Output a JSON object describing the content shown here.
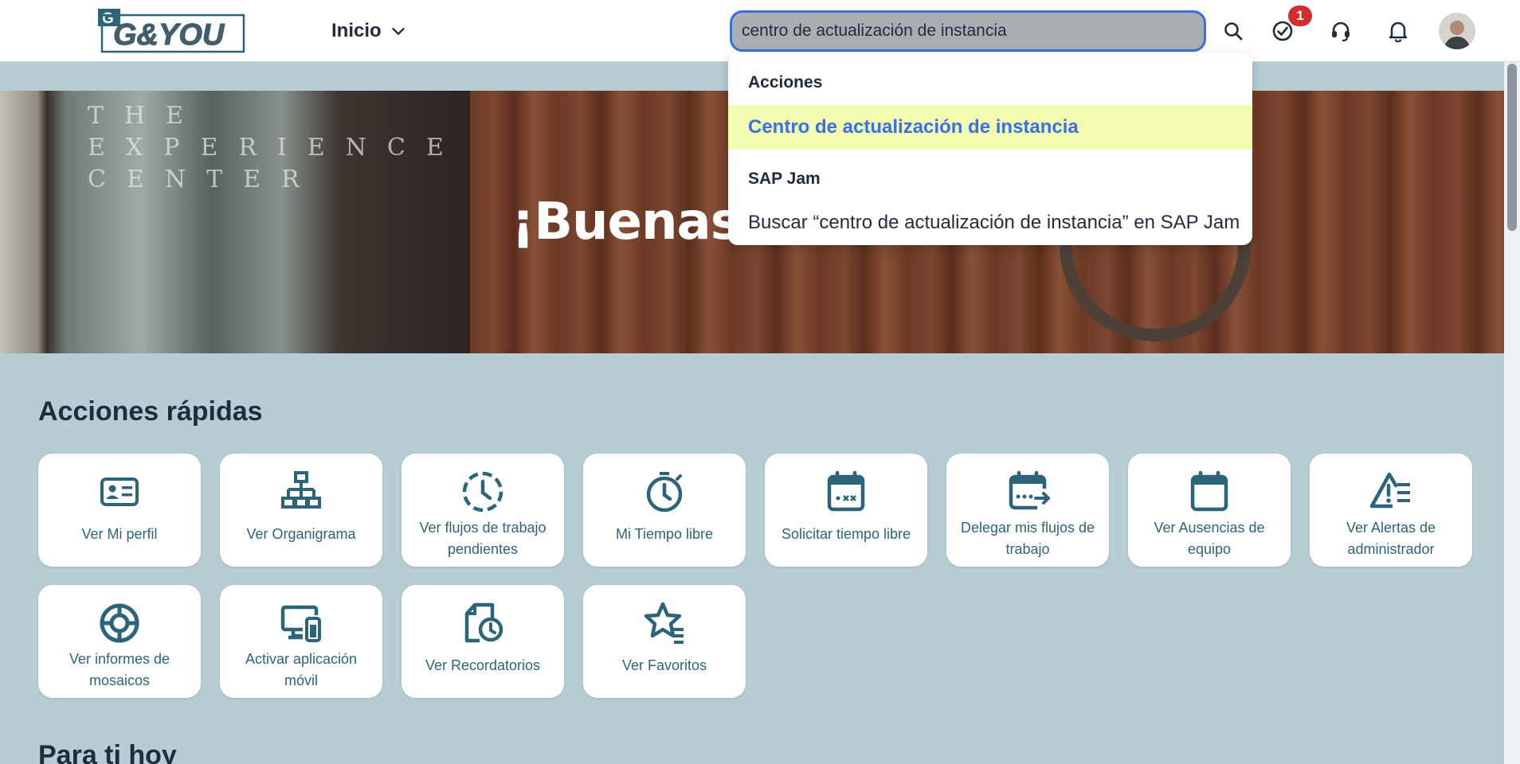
{
  "header": {
    "logo_text": "G&YOU",
    "home_label": "Inicio",
    "search_value": "centro de actualización de instancia",
    "tasks_badge": "1"
  },
  "hero": {
    "greeting": "¡Buenas",
    "engraved_text": "THE\nEXPERIENCE\nCENTER"
  },
  "quick_actions": {
    "title": "Acciones rápidas",
    "tiles": [
      {
        "label": "Ver Mi perfil",
        "icon": "id-card-icon"
      },
      {
        "label": "Ver Organigrama",
        "icon": "org-chart-icon"
      },
      {
        "label": "Ver flujos de trabajo pendientes",
        "icon": "pending-clock-icon"
      },
      {
        "label": "Mi Tiempo libre",
        "icon": "stopwatch-icon"
      },
      {
        "label": "Solicitar tiempo libre",
        "icon": "calendar-request-icon"
      },
      {
        "label": "Delegar mis flujos de trabajo",
        "icon": "calendar-forward-icon"
      },
      {
        "label": "Ver Ausencias de equipo",
        "icon": "calendar-icon"
      },
      {
        "label": "Ver Alertas de administrador",
        "icon": "alert-list-icon"
      },
      {
        "label": "Ver informes de mosaicos",
        "icon": "tile-report-icon"
      },
      {
        "label": "Activar aplicación móvil",
        "icon": "devices-icon"
      },
      {
        "label": "Ver Recordatorios",
        "icon": "reminder-icon"
      },
      {
        "label": "Ver Favoritos",
        "icon": "favorites-icon"
      }
    ]
  },
  "for_you": {
    "title": "Para ti hoy"
  },
  "search_dropdown": {
    "group1_title": "Acciones",
    "group1_item": "Centro de actualización de instancia",
    "group2_title": "SAP Jam",
    "group2_item": "Buscar “centro de actualización de instancia” en SAP Jam"
  },
  "colors": {
    "accent": "#3b6fd8",
    "page_background": "#b5cdd3",
    "tile_icon": "#2c6579",
    "highlight": "#f2fbb0",
    "badge": "#d12f2f"
  }
}
